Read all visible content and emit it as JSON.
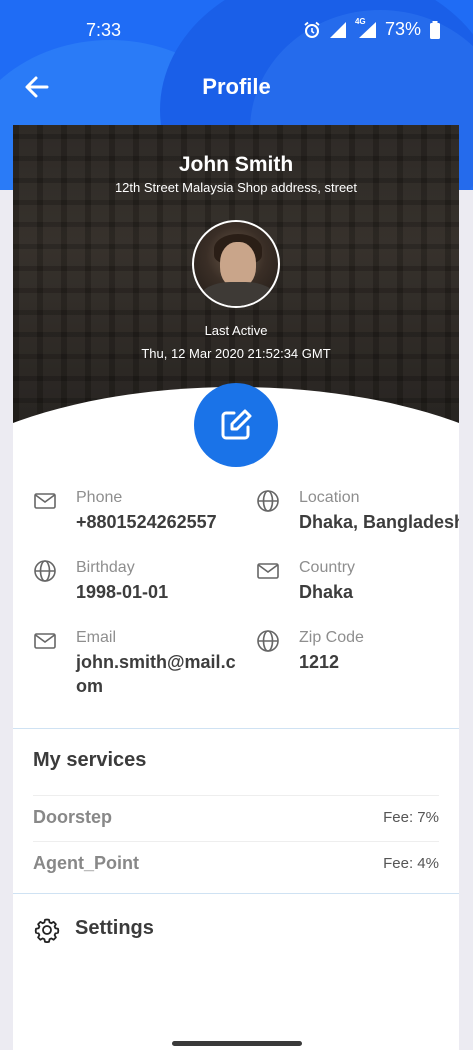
{
  "status_bar": {
    "time": "7:33",
    "network": "4G",
    "battery": "73%"
  },
  "app_bar": {
    "title": "Profile"
  },
  "profile": {
    "name": "John Smith",
    "address": "12th Street Malaysia Shop address, street",
    "last_active_label": "Last Active",
    "last_active_time": "Thu, 12 Mar 2020 21:52:34 GMT"
  },
  "info": {
    "phone": {
      "label": "Phone",
      "value": "+8801524262557",
      "icon": "mail-icon"
    },
    "location": {
      "label": "Location",
      "value": "Dhaka, Bangladesh",
      "icon": "globe-icon"
    },
    "birthday": {
      "label": "Birthday",
      "value": "1998-01-01",
      "icon": "globe-icon"
    },
    "country": {
      "label": "Country",
      "value": "Dhaka",
      "icon": "mail-icon"
    },
    "email": {
      "label": "Email",
      "value": "john.smith@mail.com",
      "icon": "mail-icon"
    },
    "zip": {
      "label": "Zip Code",
      "value": "1212",
      "icon": "globe-icon"
    }
  },
  "services": {
    "title": "My services",
    "items": [
      {
        "name": "Doorstep",
        "fee": "Fee: 7%"
      },
      {
        "name": "Agent_Point",
        "fee": "Fee: 4%"
      }
    ]
  },
  "settings": {
    "label": "Settings"
  },
  "colors": {
    "primary": "#1a73e8",
    "header": "#1f6cf5"
  }
}
